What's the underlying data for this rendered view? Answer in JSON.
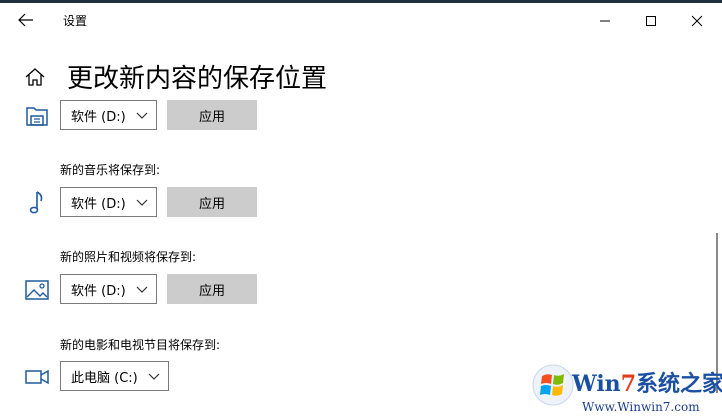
{
  "window": {
    "title": "设置",
    "controls": [
      "minimize",
      "maximize",
      "close"
    ]
  },
  "page": {
    "title": "更改新内容的保存位置"
  },
  "rows": [
    {
      "icon": "document-drive-icon",
      "label": "",
      "drive": "软件 (D:)",
      "apply": "应用"
    },
    {
      "icon": "music-note-icon",
      "label": "新的音乐将保存到:",
      "drive": "软件 (D:)",
      "apply": "应用"
    },
    {
      "icon": "picture-icon",
      "label": "新的照片和视频将保存到:",
      "drive": "软件 (D:)",
      "apply": "应用"
    },
    {
      "icon": "video-camera-icon",
      "label": "新的电影和电视节目将保存到:",
      "drive": "此电脑 (C:)"
    }
  ],
  "watermark": {
    "brand_part1": "Win",
    "brand_part2": "7",
    "brand_part3": "系统之家",
    "url": "Www.Winwin7.com"
  }
}
